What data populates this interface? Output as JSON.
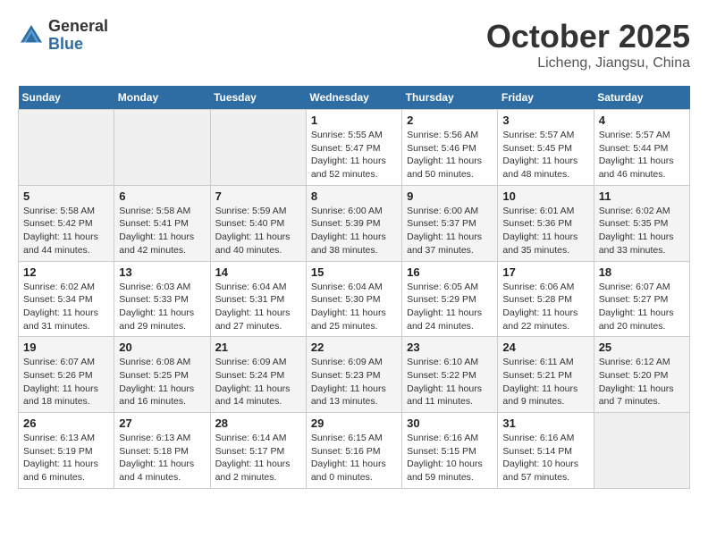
{
  "header": {
    "logo_line1": "General",
    "logo_line2": "Blue",
    "month_title": "October 2025",
    "location": "Licheng, Jiangsu, China"
  },
  "days_of_week": [
    "Sunday",
    "Monday",
    "Tuesday",
    "Wednesday",
    "Thursday",
    "Friday",
    "Saturday"
  ],
  "weeks": [
    [
      {
        "day": "",
        "detail": ""
      },
      {
        "day": "",
        "detail": ""
      },
      {
        "day": "",
        "detail": ""
      },
      {
        "day": "1",
        "detail": "Sunrise: 5:55 AM\nSunset: 5:47 PM\nDaylight: 11 hours\nand 52 minutes."
      },
      {
        "day": "2",
        "detail": "Sunrise: 5:56 AM\nSunset: 5:46 PM\nDaylight: 11 hours\nand 50 minutes."
      },
      {
        "day": "3",
        "detail": "Sunrise: 5:57 AM\nSunset: 5:45 PM\nDaylight: 11 hours\nand 48 minutes."
      },
      {
        "day": "4",
        "detail": "Sunrise: 5:57 AM\nSunset: 5:44 PM\nDaylight: 11 hours\nand 46 minutes."
      }
    ],
    [
      {
        "day": "5",
        "detail": "Sunrise: 5:58 AM\nSunset: 5:42 PM\nDaylight: 11 hours\nand 44 minutes."
      },
      {
        "day": "6",
        "detail": "Sunrise: 5:58 AM\nSunset: 5:41 PM\nDaylight: 11 hours\nand 42 minutes."
      },
      {
        "day": "7",
        "detail": "Sunrise: 5:59 AM\nSunset: 5:40 PM\nDaylight: 11 hours\nand 40 minutes."
      },
      {
        "day": "8",
        "detail": "Sunrise: 6:00 AM\nSunset: 5:39 PM\nDaylight: 11 hours\nand 38 minutes."
      },
      {
        "day": "9",
        "detail": "Sunrise: 6:00 AM\nSunset: 5:37 PM\nDaylight: 11 hours\nand 37 minutes."
      },
      {
        "day": "10",
        "detail": "Sunrise: 6:01 AM\nSunset: 5:36 PM\nDaylight: 11 hours\nand 35 minutes."
      },
      {
        "day": "11",
        "detail": "Sunrise: 6:02 AM\nSunset: 5:35 PM\nDaylight: 11 hours\nand 33 minutes."
      }
    ],
    [
      {
        "day": "12",
        "detail": "Sunrise: 6:02 AM\nSunset: 5:34 PM\nDaylight: 11 hours\nand 31 minutes."
      },
      {
        "day": "13",
        "detail": "Sunrise: 6:03 AM\nSunset: 5:33 PM\nDaylight: 11 hours\nand 29 minutes."
      },
      {
        "day": "14",
        "detail": "Sunrise: 6:04 AM\nSunset: 5:31 PM\nDaylight: 11 hours\nand 27 minutes."
      },
      {
        "day": "15",
        "detail": "Sunrise: 6:04 AM\nSunset: 5:30 PM\nDaylight: 11 hours\nand 25 minutes."
      },
      {
        "day": "16",
        "detail": "Sunrise: 6:05 AM\nSunset: 5:29 PM\nDaylight: 11 hours\nand 24 minutes."
      },
      {
        "day": "17",
        "detail": "Sunrise: 6:06 AM\nSunset: 5:28 PM\nDaylight: 11 hours\nand 22 minutes."
      },
      {
        "day": "18",
        "detail": "Sunrise: 6:07 AM\nSunset: 5:27 PM\nDaylight: 11 hours\nand 20 minutes."
      }
    ],
    [
      {
        "day": "19",
        "detail": "Sunrise: 6:07 AM\nSunset: 5:26 PM\nDaylight: 11 hours\nand 18 minutes."
      },
      {
        "day": "20",
        "detail": "Sunrise: 6:08 AM\nSunset: 5:25 PM\nDaylight: 11 hours\nand 16 minutes."
      },
      {
        "day": "21",
        "detail": "Sunrise: 6:09 AM\nSunset: 5:24 PM\nDaylight: 11 hours\nand 14 minutes."
      },
      {
        "day": "22",
        "detail": "Sunrise: 6:09 AM\nSunset: 5:23 PM\nDaylight: 11 hours\nand 13 minutes."
      },
      {
        "day": "23",
        "detail": "Sunrise: 6:10 AM\nSunset: 5:22 PM\nDaylight: 11 hours\nand 11 minutes."
      },
      {
        "day": "24",
        "detail": "Sunrise: 6:11 AM\nSunset: 5:21 PM\nDaylight: 11 hours\nand 9 minutes."
      },
      {
        "day": "25",
        "detail": "Sunrise: 6:12 AM\nSunset: 5:20 PM\nDaylight: 11 hours\nand 7 minutes."
      }
    ],
    [
      {
        "day": "26",
        "detail": "Sunrise: 6:13 AM\nSunset: 5:19 PM\nDaylight: 11 hours\nand 6 minutes."
      },
      {
        "day": "27",
        "detail": "Sunrise: 6:13 AM\nSunset: 5:18 PM\nDaylight: 11 hours\nand 4 minutes."
      },
      {
        "day": "28",
        "detail": "Sunrise: 6:14 AM\nSunset: 5:17 PM\nDaylight: 11 hours\nand 2 minutes."
      },
      {
        "day": "29",
        "detail": "Sunrise: 6:15 AM\nSunset: 5:16 PM\nDaylight: 11 hours\nand 0 minutes."
      },
      {
        "day": "30",
        "detail": "Sunrise: 6:16 AM\nSunset: 5:15 PM\nDaylight: 10 hours\nand 59 minutes."
      },
      {
        "day": "31",
        "detail": "Sunrise: 6:16 AM\nSunset: 5:14 PM\nDaylight: 10 hours\nand 57 minutes."
      },
      {
        "day": "",
        "detail": ""
      }
    ]
  ]
}
